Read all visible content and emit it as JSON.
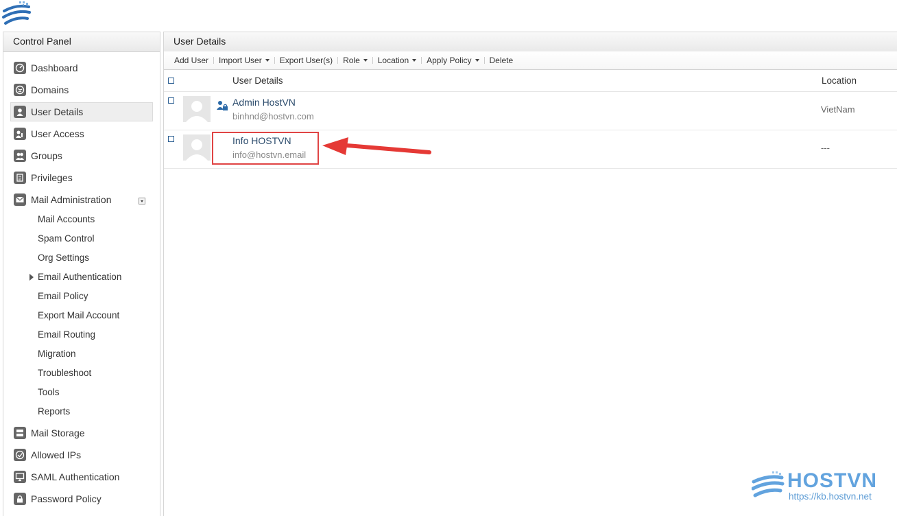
{
  "sidebar": {
    "title": "Control Panel",
    "items": [
      {
        "label": "Dashboard",
        "icon": "dashboard-icon"
      },
      {
        "label": "Domains",
        "icon": "globe-icon"
      },
      {
        "label": "User Details",
        "icon": "user-icon",
        "active": true
      },
      {
        "label": "User Access",
        "icon": "user-key-icon"
      },
      {
        "label": "Groups",
        "icon": "group-icon"
      },
      {
        "label": "Privileges",
        "icon": "document-icon"
      },
      {
        "label": "Mail Administration",
        "icon": "mail-icon"
      }
    ],
    "mail_admin_sub": [
      "Mail Accounts",
      "Spam Control",
      "Org Settings",
      "Email Authentication",
      "Email Policy",
      "Export Mail Account",
      "Email Routing",
      "Migration",
      "Troubleshoot",
      "Tools",
      "Reports"
    ],
    "bottom_items": [
      {
        "label": "Mail Storage",
        "icon": "storage-icon"
      },
      {
        "label": "Allowed IPs",
        "icon": "ip-icon"
      },
      {
        "label": "SAML Authentication",
        "icon": "monitor-icon"
      },
      {
        "label": "Password Policy",
        "icon": "lock-icon"
      }
    ]
  },
  "main": {
    "title": "User Details",
    "toolbar": {
      "add_user": "Add User",
      "import_user": "Import User",
      "export_users": "Export User(s)",
      "role": "Role",
      "location": "Location",
      "apply_policy": "Apply Policy",
      "delete": "Delete"
    },
    "columns": {
      "details": "User Details",
      "location": "Location"
    },
    "users": [
      {
        "name": "Admin HostVN",
        "email": "binhnd@hostvn.com",
        "location": "VietNam",
        "admin": true
      },
      {
        "name": "Info HOSTVN",
        "email": "info@hostvn.email",
        "location": "---",
        "admin": false
      }
    ]
  },
  "watermark": {
    "brand": "HOSTVN",
    "url": "https://kb.hostvn.net"
  },
  "colors": {
    "accent": "#2c5f93",
    "highlight": "#e04444",
    "brand": "#62a3de"
  }
}
